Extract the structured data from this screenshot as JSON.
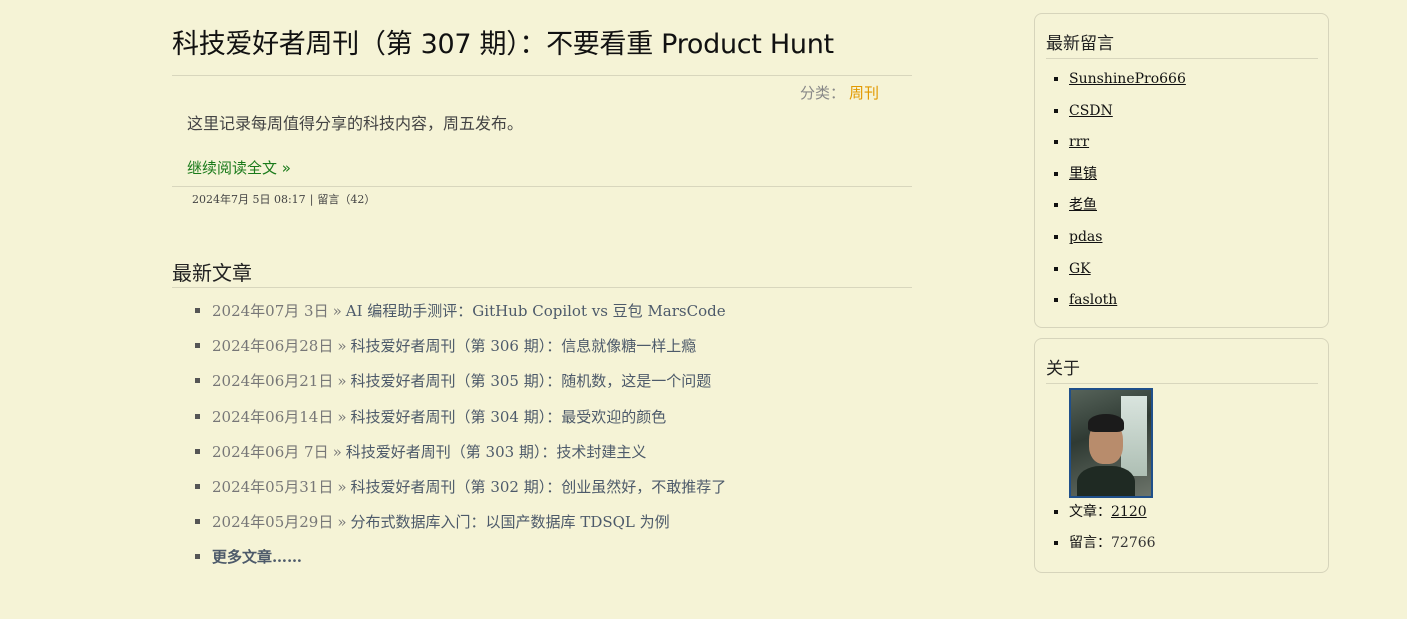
{
  "post": {
    "title": "科技爱好者周刊（第 307 期）：不要看重 Product Hunt",
    "category_label": "分类：",
    "category_value": "周刊",
    "excerpt": "这里记录每周值得分享的科技内容，周五发布。",
    "read_more": "继续阅读全文 »",
    "date": "2024年7月 5日 08:17",
    "separator": "|",
    "comments": "留言（42）"
  },
  "latest": {
    "title": "最新文章",
    "arrow": "»",
    "items": [
      {
        "date": "2024年07月 3日",
        "title": "AI 编程助手测评：GitHub Copilot vs 豆包 MarsCode"
      },
      {
        "date": "2024年06月28日",
        "title": "科技爱好者周刊（第 306 期）：信息就像糖一样上瘾"
      },
      {
        "date": "2024年06月21日",
        "title": "科技爱好者周刊（第 305 期）：随机数，这是一个问题"
      },
      {
        "date": "2024年06月14日",
        "title": "科技爱好者周刊（第 304 期）：最受欢迎的颜色"
      },
      {
        "date": "2024年06月 7日",
        "title": "科技爱好者周刊（第 303 期）：技术封建主义"
      },
      {
        "date": "2024年05月31日",
        "title": "科技爱好者周刊（第 302 期）：创业虽然好，不敢推荐了"
      },
      {
        "date": "2024年05月29日",
        "title": "分布式数据库入门：以国产数据库 TDSQL 为例"
      }
    ],
    "more": "更多文章……"
  },
  "sidebar": {
    "comments_title": "最新留言",
    "commenters": [
      "SunshinePro666",
      "CSDN",
      "rrr",
      "里镇",
      "老鱼",
      "pdas",
      "GK",
      "fasloth"
    ],
    "about_title": "关于",
    "stats": [
      {
        "label": "文章：",
        "value": "2120"
      },
      {
        "label": "留言：",
        "value": "72766"
      }
    ]
  },
  "colors": {
    "background": "#f5f3d6",
    "category_link": "#e29900",
    "read_more": "#1a7a1a",
    "list_link": "#4d5a6a"
  }
}
